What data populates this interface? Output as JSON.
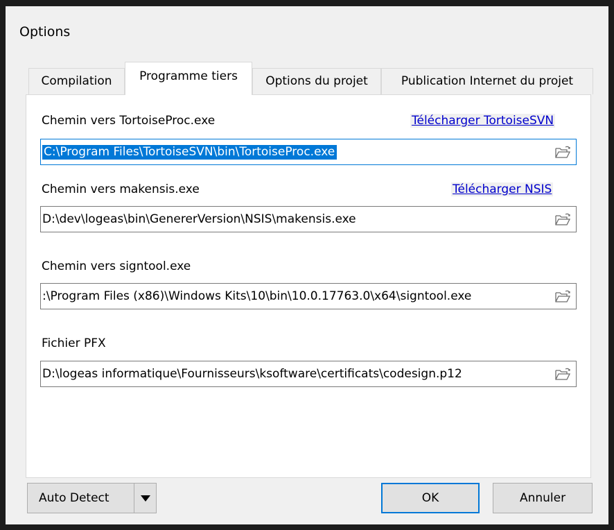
{
  "dialog": {
    "title": "Options"
  },
  "tabs": [
    {
      "label": "Compilation",
      "active": false
    },
    {
      "label": "Programme tiers",
      "active": true
    },
    {
      "label": "Options du projet",
      "active": false
    },
    {
      "label": "Publication Internet du projet",
      "active": false
    }
  ],
  "fields": {
    "tortoiseproc": {
      "label": "Chemin vers TortoiseProc.exe",
      "value": "C:\\Program Files\\TortoiseSVN\\bin\\TortoiseProc.exe",
      "link": "Télécharger TortoiseSVN",
      "selected": true
    },
    "makensis": {
      "label": "Chemin vers makensis.exe",
      "value": "D:\\dev\\logeas\\bin\\GenererVersion\\NSIS\\makensis.exe",
      "link": "Télécharger NSIS"
    },
    "signtool": {
      "label": "Chemin vers signtool.exe",
      "value": ":\\Program Files (x86)\\Windows Kits\\10\\bin\\10.0.17763.0\\x64\\signtool.exe"
    },
    "pfx": {
      "label": "Fichier PFX",
      "value": "D:\\logeas informatique\\Fournisseurs\\ksoftware\\certificats\\codesign.p12"
    }
  },
  "buttons": {
    "auto_detect": "Auto Detect",
    "ok": "OK",
    "cancel": "Annuler"
  },
  "icons": {
    "browse": "open-folder-icon",
    "dropdown": "triangle-down-icon"
  },
  "colors": {
    "selection": "#0078d7",
    "link": "#0000cc",
    "dialog_bg": "#f0f0f0",
    "panel_bg": "#ffffff"
  }
}
